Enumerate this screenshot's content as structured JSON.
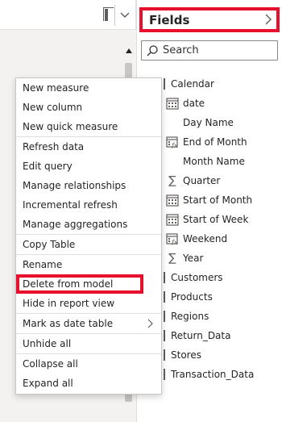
{
  "fields_pane": {
    "title": "Fields",
    "search_placeholder": "Search",
    "highlight_color": "#e8112d",
    "items": [
      {
        "label": "Calendar",
        "icon": "table-icon"
      },
      {
        "label": "date",
        "icon": "calendar-icon"
      },
      {
        "label": "Day Name",
        "icon": "none"
      },
      {
        "label": "End of Month",
        "icon": "calendar-calculated-icon"
      },
      {
        "label": "Month Name",
        "icon": "none"
      },
      {
        "label": "Quarter",
        "icon": "sigma-icon"
      },
      {
        "label": "Start of Month",
        "icon": "calendar-icon"
      },
      {
        "label": "Start of Week",
        "icon": "calendar-icon"
      },
      {
        "label": "Weekend",
        "icon": "calendar-calculated-icon"
      },
      {
        "label": "Year",
        "icon": "sigma-icon"
      },
      {
        "label": "Customers",
        "icon": "table-icon"
      },
      {
        "label": "Products",
        "icon": "table-icon"
      },
      {
        "label": "Regions",
        "icon": "table-icon"
      },
      {
        "label": "Return_Data",
        "icon": "table-icon"
      },
      {
        "label": "Stores",
        "icon": "table-icon"
      },
      {
        "label": "Transaction_Data",
        "icon": "table-icon"
      }
    ]
  },
  "context_menu": {
    "items": [
      {
        "label": "New measure"
      },
      {
        "label": "New column"
      },
      {
        "label": "New quick measure"
      },
      {
        "label": "Refresh data"
      },
      {
        "label": "Edit query"
      },
      {
        "label": "Manage relationships"
      },
      {
        "label": "Incremental refresh"
      },
      {
        "label": "Manage aggregations"
      },
      {
        "label": "Copy Table"
      },
      {
        "label": "Rename"
      },
      {
        "label": "Delete from model"
      },
      {
        "label": "Hide in report view"
      },
      {
        "label": "Mark as date table"
      },
      {
        "label": "Unhide all"
      },
      {
        "label": "Collapse all"
      },
      {
        "label": "Expand all"
      }
    ]
  }
}
